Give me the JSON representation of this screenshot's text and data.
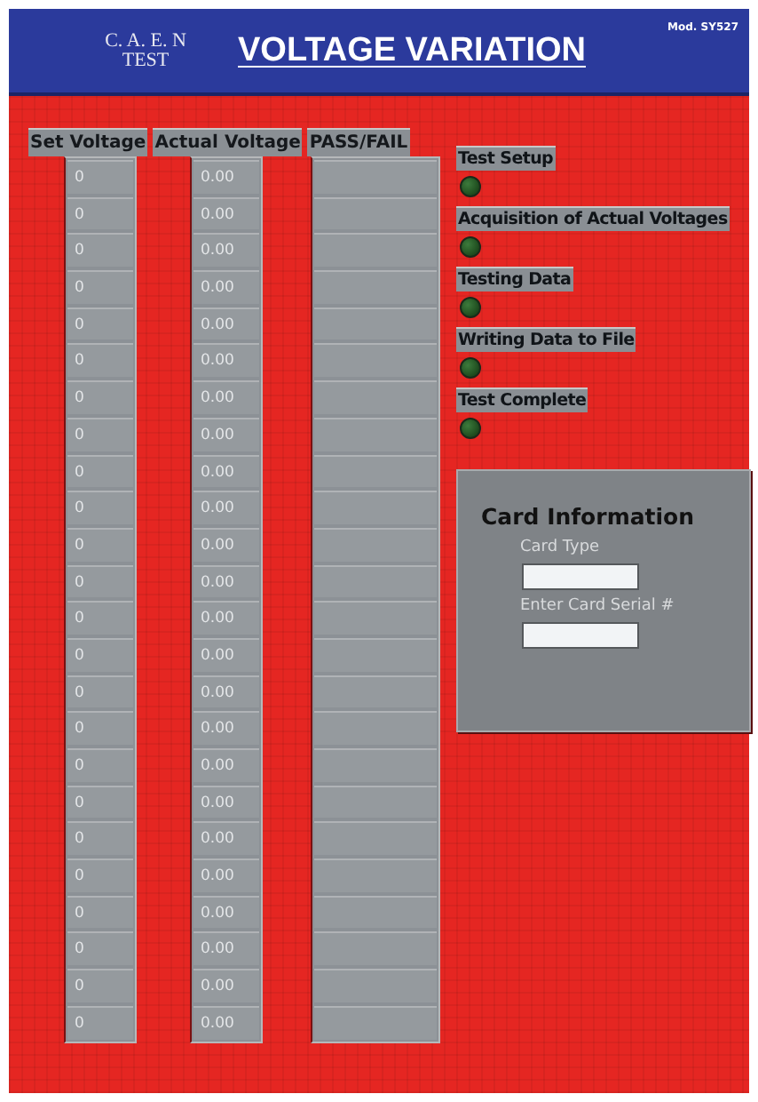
{
  "header": {
    "logo_line_1": "C. A. E. N",
    "logo_line_2": "TEST",
    "title": "VOLTAGE VARIATION",
    "model": "Mod. SY527"
  },
  "table": {
    "columns": [
      "Set Voltage",
      "Actual Voltage",
      "PASS/FAIL"
    ],
    "rows": [
      {
        "set": "0",
        "actual": "0.00"
      },
      {
        "set": "0",
        "actual": "0.00"
      },
      {
        "set": "0",
        "actual": "0.00"
      },
      {
        "set": "0",
        "actual": "0.00"
      },
      {
        "set": "0",
        "actual": "0.00"
      },
      {
        "set": "0",
        "actual": "0.00"
      },
      {
        "set": "0",
        "actual": "0.00"
      },
      {
        "set": "0",
        "actual": "0.00"
      },
      {
        "set": "0",
        "actual": "0.00"
      },
      {
        "set": "0",
        "actual": "0.00"
      },
      {
        "set": "0",
        "actual": "0.00"
      },
      {
        "set": "0",
        "actual": "0.00"
      },
      {
        "set": "0",
        "actual": "0.00"
      },
      {
        "set": "0",
        "actual": "0.00"
      },
      {
        "set": "0",
        "actual": "0.00"
      },
      {
        "set": "0",
        "actual": "0.00"
      },
      {
        "set": "0",
        "actual": "0.00"
      },
      {
        "set": "0",
        "actual": "0.00"
      },
      {
        "set": "0",
        "actual": "0.00"
      },
      {
        "set": "0",
        "actual": "0.00"
      },
      {
        "set": "0",
        "actual": "0.00"
      },
      {
        "set": "0",
        "actual": "0.00"
      },
      {
        "set": "0",
        "actual": "0.00"
      },
      {
        "set": "0",
        "actual": "0.00"
      }
    ]
  },
  "indicators": [
    {
      "label": "Test Setup",
      "on": false
    },
    {
      "label": "Acquisition of Actual Voltages",
      "on": false
    },
    {
      "label": "Testing Data",
      "on": false
    },
    {
      "label": "Writing Data to File",
      "on": false
    },
    {
      "label": "Test Complete",
      "on": false
    }
  ],
  "card_information": {
    "title": "Card Information",
    "fields": [
      {
        "label": "Card Type"
      },
      {
        "label": "Enter Card Serial #"
      }
    ]
  }
}
